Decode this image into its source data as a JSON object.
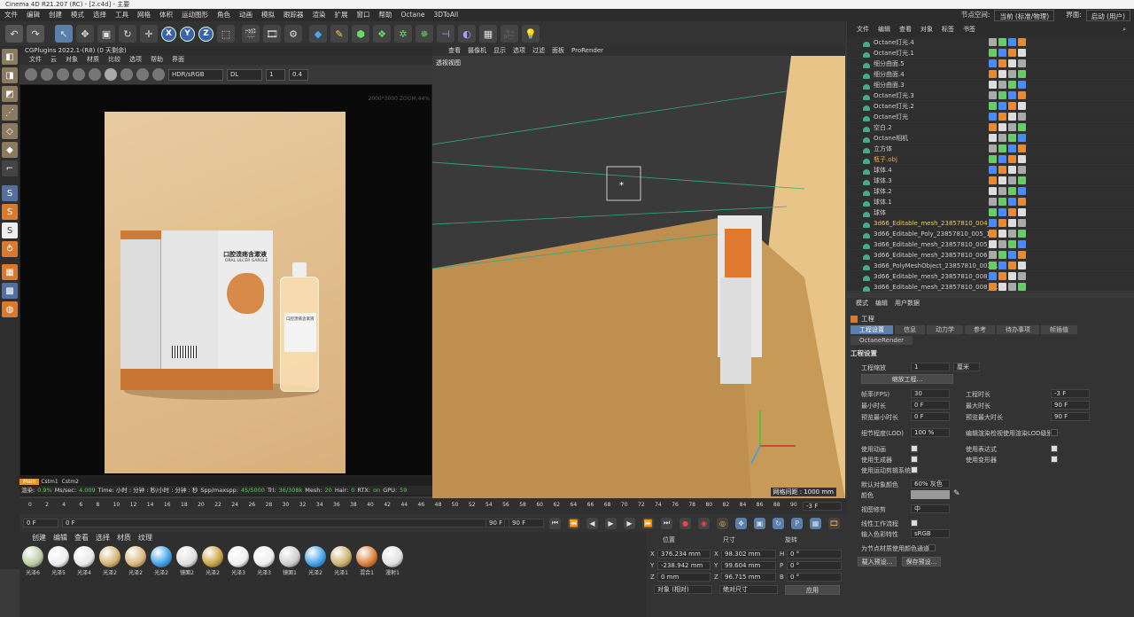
{
  "window_title": "Cinema 4D R21.207 (RC) - [2.c4d] - 主要",
  "menu": [
    "文件",
    "编辑",
    "创建",
    "模式",
    "选择",
    "工具",
    "网格",
    "体积",
    "运动图形",
    "角色",
    "动画",
    "模拟",
    "跟踪器",
    "渲染",
    "扩展",
    "窗口",
    "帮助",
    "Octane",
    "3DToAll"
  ],
  "menu_right": {
    "node_space_label": "节点空间:",
    "node_space_value": "当前 (标准/物理)",
    "layout_label": "界面:",
    "layout_value": "启动 (用户)"
  },
  "octane": {
    "header": "CGPlugins  2022.1-(R8) (0 天剩余)",
    "menu": [
      "文件",
      "云",
      "对象",
      "材质",
      "比较",
      "选项",
      "帮助",
      "界面"
    ],
    "hdr_select": "HDR/sRGB",
    "dl_select": "DL",
    "value1": "1",
    "value2": "0.4",
    "zoom_text": "2000*3000 ZOOM:44%",
    "tabs": [
      "Main",
      "Cstm1",
      "Cstm2"
    ],
    "status": {
      "render_label": "渲染:",
      "render_val": "0.9%",
      "ms_label": "Ms/sec:",
      "ms_val": "4.009",
      "time_label": "Time: 小时 : 分钟 : 秒/小时 : 分钟 : 秒",
      "spp_label": "Spp/maxspp:",
      "spp_val": "45/5000",
      "tri_label": "Tri:",
      "tri_val": "36/308k",
      "mesh_label": "Mesh:",
      "mesh_val": "20",
      "hair_label": "Hair:",
      "hair_val": "0",
      "rtx_label": "RTX:",
      "rtx_val": "on",
      "gpu_label": "GPU:",
      "gpu_val": "59"
    },
    "box_title_cn": "口腔溃疡含漱液",
    "box_title_en": "ORAL ULCER GARGLE",
    "bottle_title": "口腔溃疡含漱液"
  },
  "viewport": {
    "menu": [
      "查看",
      "摄像机",
      "显示",
      "选项",
      "过滤",
      "面板",
      "ProRender"
    ],
    "label": "透视视图",
    "grid_text": "网格间距 : 1000 mm"
  },
  "objects": {
    "menu": [
      "文件",
      "编辑",
      "查看",
      "对象",
      "标签",
      "书签"
    ],
    "rows": [
      {
        "name": "Octane灯光.4",
        "color": "#ccc"
      },
      {
        "name": "Octane灯光.1",
        "color": "#ccc"
      },
      {
        "name": "细分曲面.5",
        "color": "#ccc"
      },
      {
        "name": "细分曲面.4",
        "color": "#ccc"
      },
      {
        "name": "细分曲面.3",
        "color": "#ccc"
      },
      {
        "name": "Octane灯光.3",
        "color": "#ccc"
      },
      {
        "name": "Octane灯光.2",
        "color": "#ccc"
      },
      {
        "name": "Octane灯光",
        "color": "#ccc"
      },
      {
        "name": "空白.2",
        "color": "#ccc"
      },
      {
        "name": "Octane相机",
        "color": "#ccc"
      },
      {
        "name": "立方体",
        "color": "#ccc"
      },
      {
        "name": "瓶子.obj",
        "color": "#e8a840"
      },
      {
        "name": "球体.4",
        "color": "#ccc"
      },
      {
        "name": "球体.3",
        "color": "#ccc"
      },
      {
        "name": "球体.2",
        "color": "#ccc"
      },
      {
        "name": "球体.1",
        "color": "#ccc"
      },
      {
        "name": "球体",
        "color": "#ccc"
      },
      {
        "name": "3d66_Editable_mesh_23857810_004_1",
        "color": "#f0d040"
      },
      {
        "name": "3d66_Editable_Poly_23857810_005_1",
        "color": "#ccc"
      },
      {
        "name": "3d66_Editable_mesh_23857810_005_1",
        "color": "#ccc"
      },
      {
        "name": "3d66_Editable_mesh_23857810_006_1",
        "color": "#ccc"
      },
      {
        "name": "3d66_PolyMeshObject_23857810_003_1",
        "color": "#ccc"
      },
      {
        "name": "3d66_Editable_mesh_23857810_008_1",
        "color": "#ccc"
      },
      {
        "name": "3d66_Editable_mesh_23857810_008_1.2",
        "color": "#ccc"
      }
    ]
  },
  "attributes": {
    "menu": [
      "模式",
      "编辑",
      "用户数据"
    ],
    "title": "工程",
    "tabs": [
      "工程设置",
      "信息",
      "动力学",
      "参考",
      "待办事项",
      "帧插值"
    ],
    "tab2": "OctaneRender",
    "section": "工程设置",
    "scale_label": "工程缩放",
    "scale_val": "1",
    "scale_unit": "厘米",
    "scale_btn": "缩放工程...",
    "fps_label": "帧率(FPS)",
    "fps_val": "30",
    "duration_label": "工程时长",
    "duration_val": "-3 F",
    "min_label": "最小时长",
    "min_val": "0 F",
    "max_label": "最大时长",
    "max_val": "90 F",
    "pmin_label": "预览最小时长",
    "pmin_val": "0 F",
    "pmax_label": "预览最大时长",
    "pmax_val": "90 F",
    "lod_label": "细节程度(LOD)",
    "lod_val": "100 %",
    "lod_render_label": "编辑渲染检视使用渲染LOD级别",
    "use_anim": "使用动画",
    "use_expr": "使用表达式",
    "use_gen": "使用生成器",
    "use_deform": "使用变形器",
    "use_motion": "使用运动剪辑系统",
    "default_color_label": "默认对象颜色",
    "default_color_val": "60% 灰色",
    "color_label": "颜色",
    "view_clip_label": "视图修剪",
    "view_clip_val": "中",
    "linear_label": "线性工作流程",
    "input_color_label": "输入色彩特性",
    "input_color_val": "sRGB",
    "node_color_label": "为节点材质使用颜色通道",
    "load_btn": "载入预设...",
    "save_btn": "保存预设..."
  },
  "timeline": {
    "ticks": [
      "0",
      "2",
      "4",
      "6",
      "8",
      "10",
      "12",
      "14",
      "16",
      "18",
      "20",
      "22",
      "24",
      "26",
      "28",
      "30",
      "32",
      "34",
      "36",
      "38",
      "40",
      "42",
      "44",
      "46",
      "48",
      "50",
      "52",
      "54",
      "56",
      "58",
      "60",
      "62",
      "64",
      "66",
      "68",
      "70",
      "72",
      "74",
      "76",
      "78",
      "80",
      "82",
      "84",
      "86",
      "88",
      "90"
    ],
    "current": "-3 F",
    "start": "0 F",
    "start2": "0 F",
    "end": "90 F",
    "end2": "90 F"
  },
  "materials": {
    "menu": [
      "创建",
      "编辑",
      "查看",
      "选择",
      "材质",
      "纹理"
    ],
    "items": [
      {
        "name": "光泽6",
        "color": "#b8c8a0"
      },
      {
        "name": "光泽5",
        "color": "#eeeeee"
      },
      {
        "name": "光泽4",
        "color": "#e8e8e8"
      },
      {
        "name": "光泽2",
        "color": "#d4b070"
      },
      {
        "name": "光泽2",
        "color": "#d8b478"
      },
      {
        "name": "光泽2",
        "color": "#3a9ee8"
      },
      {
        "name": "镜面2",
        "color": "#dddddd"
      },
      {
        "name": "光泽2",
        "color": "#c8a040"
      },
      {
        "name": "光泽3",
        "color": "#f0f0f0"
      },
      {
        "name": "光泽3",
        "color": "#eeeeee"
      },
      {
        "name": "镜面1",
        "color": "#cccccc"
      },
      {
        "name": "光泽2",
        "color": "#3a9ee8"
      },
      {
        "name": "光泽1",
        "color": "#c8b068"
      },
      {
        "name": "混合1",
        "color": "#d87a30"
      },
      {
        "name": "漫射1",
        "color": "#e0e0e0"
      }
    ]
  },
  "coords": {
    "pos_label": "位置",
    "size_label": "尺寸",
    "rot_label": "旋转",
    "x": "376.234 mm",
    "y": "-238.942 mm",
    "z": "0 mm",
    "sx": "98.302 mm",
    "sy": "99.604 mm",
    "sz": "96.715 mm",
    "h": "0 °",
    "p": "0 °",
    "b": "0 °",
    "mode": "对象 (相对)",
    "size_mode": "绝对尺寸",
    "apply": "应用"
  }
}
